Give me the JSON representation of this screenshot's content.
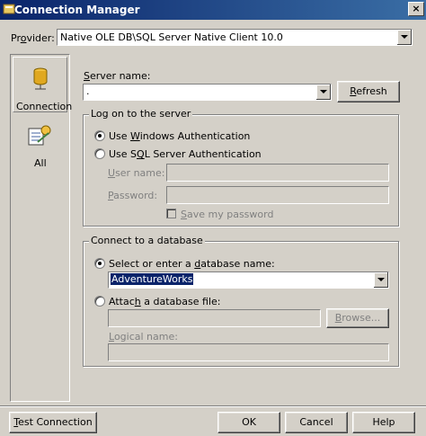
{
  "window": {
    "title": "Connection Manager",
    "close_glyph": "×"
  },
  "provider": {
    "label_pre": "Pr",
    "label_u": "o",
    "label_post": "vider:",
    "value": "Native OLE DB\\SQL Server Native Client 10.0"
  },
  "nav": {
    "items": [
      {
        "label": "Connection",
        "icon": "database-icon",
        "selected": true
      },
      {
        "label": "All",
        "icon": "properties-icon",
        "selected": false
      }
    ]
  },
  "server": {
    "label_u": "S",
    "label_post": "erver name:",
    "value": ".",
    "refresh_u": "R",
    "refresh_post": "efresh"
  },
  "logon": {
    "legend": "Log on to the server",
    "windows_pre": "Use ",
    "windows_u": "W",
    "windows_post": "indows Authentication",
    "sql_pre": "Use S",
    "sql_u": "Q",
    "sql_post": "L Server Authentication",
    "username_pre": "",
    "username_u": "U",
    "username_post": "ser name:",
    "password_pre": "",
    "password_u": "P",
    "password_post": "assword:",
    "save_pre": "",
    "save_u": "S",
    "save_post": "ave my password",
    "windows_selected": true
  },
  "database": {
    "legend": "Connect to a database",
    "select_pre": "Select or enter a ",
    "select_u": "d",
    "select_post": "atabase name:",
    "db_value": "AdventureWorks",
    "attach_pre": "Attac",
    "attach_u": "h",
    "attach_post": " a database file:",
    "browse_pre": "",
    "browse_u": "B",
    "browse_post": "rowse...",
    "logical_pre": "",
    "logical_u": "L",
    "logical_post": "ogical name:",
    "select_selected": true
  },
  "footer": {
    "test_pre": "",
    "test_u": "T",
    "test_post": "est Connection",
    "ok": "OK",
    "cancel": "Cancel",
    "help": "Help"
  },
  "colors": {
    "title_start": "#0a246a",
    "title_end": "#3a6ea5",
    "face": "#d4d0c8",
    "highlight": "#0a246a"
  }
}
